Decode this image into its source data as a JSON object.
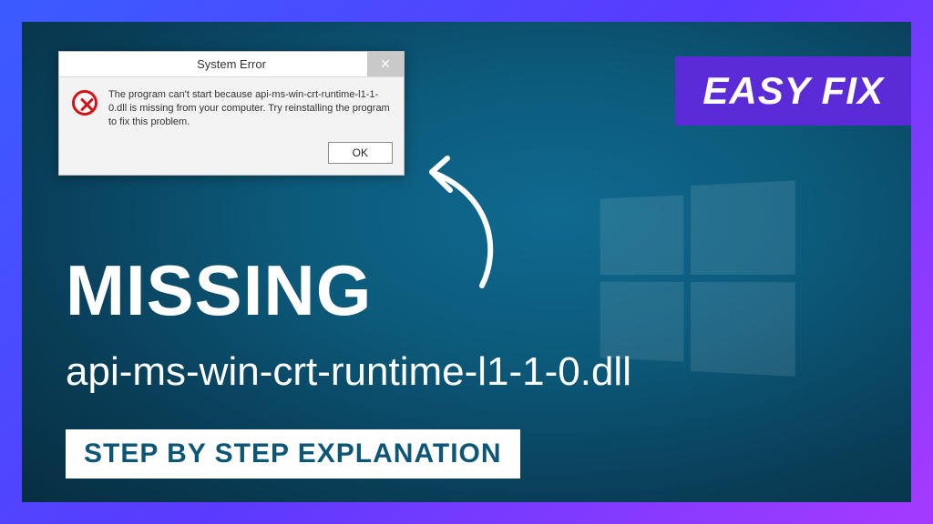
{
  "badge_easyfix": "EASY FIX",
  "dialog": {
    "title": "System Error",
    "message": "The program can't start because api-ms-win-crt-runtime-l1-1-0.dll is missing from your computer. Try reinstalling the program to fix this problem.",
    "ok_label": "OK",
    "close_glyph": "✕"
  },
  "headline": "MISSING",
  "filename": "api-ms-win-crt-runtime-l1-1-0.dll",
  "badge_steps": "STEP BY STEP EXPLANATION"
}
